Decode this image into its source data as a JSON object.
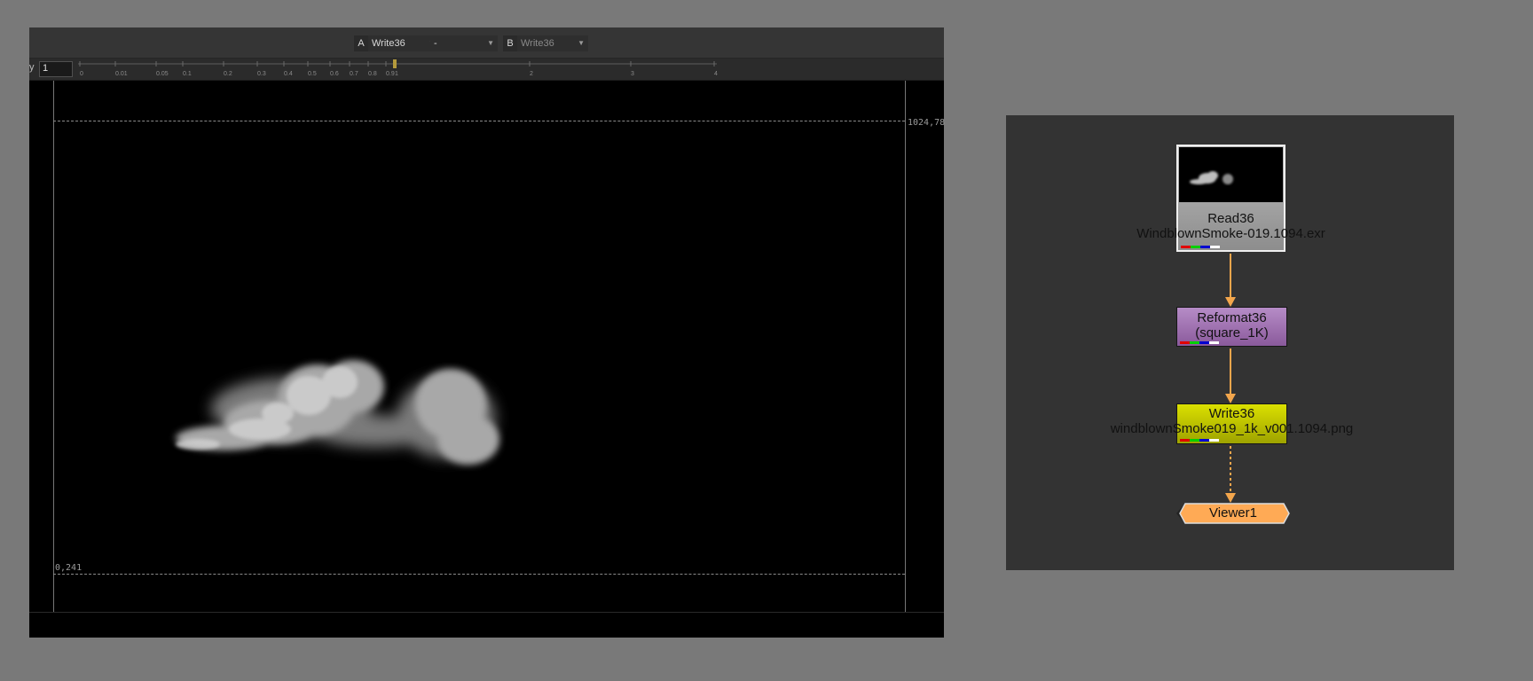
{
  "viewer": {
    "input_a": {
      "letter": "A",
      "node": "Write36"
    },
    "operation": "-",
    "input_b": {
      "letter": "B",
      "node": "Write36"
    },
    "gain_label": "y",
    "gain_value": "1",
    "gain_ticks": [
      "0",
      "0.01",
      "0.05",
      "0.1",
      "0.2",
      "0.3",
      "0.4",
      "0.5",
      "0.6",
      "0.7",
      "0.8",
      "0.9",
      "1",
      "2",
      "3",
      "4"
    ],
    "format_top_right": "1024,78",
    "format_bottom_left": "0,241"
  },
  "node_graph": {
    "read": {
      "name": "Read36",
      "file": "WindblownSmoke-019.1094.exr"
    },
    "reformat": {
      "name": "Reformat36",
      "format": "(square_1K)"
    },
    "write": {
      "name": "Write36",
      "file": "windblownSmoke019_1k_v001.1094.png"
    },
    "viewer": {
      "name": "Viewer1"
    }
  },
  "colors": {
    "read_node": "#a3a3a3",
    "reformat_node": "#9d6bae",
    "write_node": "#c9cc00",
    "viewer_node": "#ffaa55",
    "edge": "#f3a64c"
  }
}
